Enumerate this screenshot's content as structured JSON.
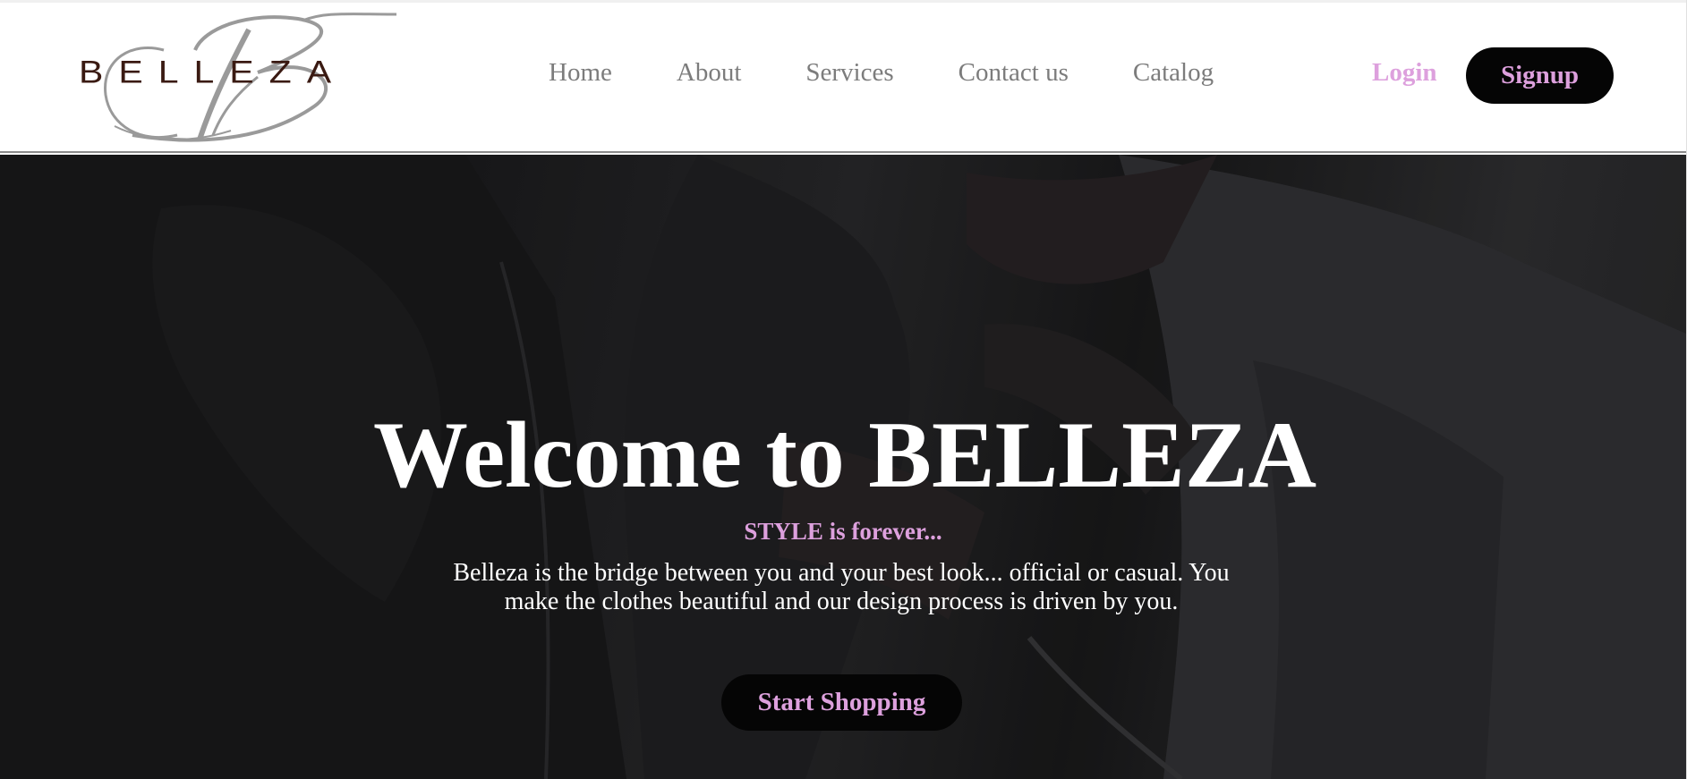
{
  "colors": {
    "accent_pink": "#dda0dd",
    "button_bg": "#050505",
    "nav_text": "#7c7c7c",
    "logo_text": "#3a1a12",
    "logo_monogram": "#9a9a9a",
    "hero_text": "#ffffff"
  },
  "header": {
    "logo": {
      "wordmark": "BELLEZA",
      "monogram": "B",
      "icon": "belleza-monogram-logo"
    },
    "nav": {
      "items": [
        {
          "label": "Home"
        },
        {
          "label": "About"
        },
        {
          "label": "Services"
        },
        {
          "label": "Contact us"
        },
        {
          "label": "Catalog"
        }
      ]
    },
    "auth": {
      "login_label": "Login",
      "signup_label": "Signup"
    }
  },
  "hero": {
    "title": "Welcome to BELLEZA",
    "tagline": "STYLE is forever...",
    "description": "Belleza is the bridge between you and your best look... official or casual. You make the clothes beautiful and our design process is driven by you.",
    "cta_label": "Start Shopping"
  }
}
